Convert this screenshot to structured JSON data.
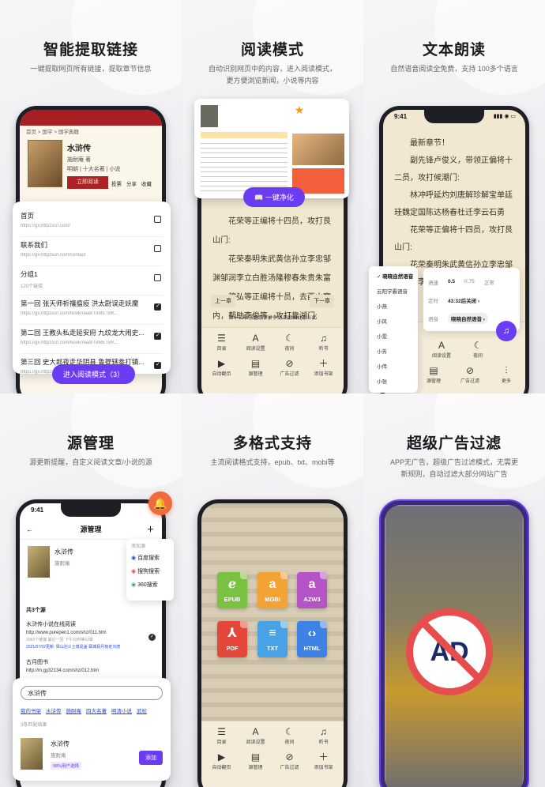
{
  "panels": [
    {
      "title": "智能提取链接",
      "subtitle": "一键提取网页所有链接，提取章节信息"
    },
    {
      "title": "阅读模式",
      "subtitle": "自动识别网页中的内容，进入阅读模式，更方便浏览新闻，小说等内容"
    },
    {
      "title": "文本朗读",
      "subtitle": "自然语音阅读全免费，支持 100多个语言"
    },
    {
      "title": "源管理",
      "subtitle": "源更新提醒，自定义阅读文章/小说的源"
    },
    {
      "title": "多格式支持",
      "subtitle": "主流阅读格式支持，epub、txt、mobi等"
    },
    {
      "title": "超级广告过滤",
      "subtitle": "APP无广告，超级广告过滤模式，无需更新规则，自动过滤大部分网站广告"
    }
  ],
  "p1": {
    "breadcrumb": "首页 > 国学 > 国学典籍",
    "book_title": "水浒传",
    "author": "施耐庵 著",
    "tags": "明朝 | 十大名著 | 小说",
    "read_btn": "立即阅读",
    "actions": [
      "投票",
      "分享",
      "收藏"
    ],
    "links": [
      {
        "title": "首页",
        "url": "https://gx.httpzscn.com/"
      },
      {
        "title": "联系我们",
        "url": "https://gx.httpzscn.com/contact"
      },
      {
        "title": "分组1",
        "url": "120个链接"
      },
      {
        "title": "第一回 张天师祈禳瘟疫 洪太尉误走妖魔",
        "url": "https://gx.httpzscn.com/book/read/T8METBK..."
      },
      {
        "title": "第二回 王教头私走延安府 九纹龙大闹史...",
        "url": "https://gx.httpzscn.com/book/read/T8METBK..."
      },
      {
        "title": "第三回 史大郎夜走华阴县 鲁提辖拳打镇...",
        "url": "https://gx.httpzscn.com/book/read/T8METBK..."
      }
    ],
    "enter_btn": "进入阅读模式（3）"
  },
  "p2": {
    "clean_btn": "一键净化",
    "paragraphs": [
      "花荣等正编将十四员，攻打艮山门:",
      "花荣秦明朱武黄信孙立李忠邹渊邹润李立白胜汤隆穆春朱贵朱富",
      "穆弘等正编将十员，去西山寨内，帮助李俊等，攻打靠湖门:"
    ],
    "prev": "上一章",
    "next": "下一章",
    "chapter": "第十三章 放色情节拼争动 再掀国北京斗武",
    "toolbar1": [
      "目录",
      "阅读设置",
      "夜间",
      "听书"
    ],
    "toolbar2": [
      "自动翻页",
      "源管理",
      "广告过滤",
      "添加书架"
    ]
  },
  "p3": {
    "time": "9:41",
    "paragraphs": [
      "最新章节！",
      "副先锋卢俊义，带领正偏将十二员，攻打候潮门:",
      "林冲呼延灼刘唐解珍解宝单廷珪魏定国陈达杨春杜迁李云石勇",
      "花荣等正偏将十四员，攻打艮山门:",
      "花荣秦明朱武黄信孙立李忠邹渊邹润李立白胜汤隆穆春朱贵朱富",
      "穆弘等正偏将十员，去西山寨内，帮助李俊"
    ],
    "voices": [
      "晓晓自然语音",
      "云阳学霸语音",
      "小燕",
      "小风",
      "小雯",
      "小芳",
      "小伟",
      "小张"
    ],
    "speed_label": "语速",
    "speeds": [
      "0.5",
      "0.75",
      "正常"
    ],
    "timer_label": "定时",
    "timer_value": "43:32后关闭 ›",
    "voice_label": "语音",
    "voice_value": "晓晓自然语音 ›",
    "toolbar": [
      "阅读设置",
      "夜间",
      "源管理",
      "广告过滤",
      "更多"
    ]
  },
  "p4": {
    "time": "9:41",
    "header": "源管理",
    "book_title": "水浒传",
    "book_author": "施耐庵",
    "source_count": "共3个源",
    "sources": [
      {
        "name": "水浒传小说在线阅读",
        "url": "http://www.purepen1.com/shz/011.htm",
        "meta": "2062个链接  最近一回 下午10时等12章",
        "note": "2021/07/02更新: 梁山泊义士尊晁盖 郓城县月夜走刘唐"
      },
      {
        "name": "古月图书",
        "url": "http://m.gy32134.com/shz/012.htm",
        "meta": "",
        "note": ""
      }
    ],
    "engine_title": "添加源",
    "engines": [
      "百度搜索",
      "搜狗搜索",
      "360搜索"
    ],
    "search_value": "水浒传",
    "search_tags": [
      "我的书架",
      "水浒传",
      "施耐庵",
      "四大名著",
      "明清小说",
      "武松"
    ],
    "result_count": "3条匹配结果",
    "result_title": "水浒传",
    "result_author": "施耐庵",
    "result_badge": "98%用户选择",
    "add_btn": "添加"
  },
  "p5": {
    "formats": [
      {
        "name": "EPUB",
        "glyph": "ℯ",
        "color": "#7cc242"
      },
      {
        "name": "MOBI",
        "glyph": "a",
        "color": "#f2a334"
      },
      {
        "name": "AZW3",
        "glyph": "a",
        "color": "#b653c7"
      },
      {
        "name": "PDF",
        "glyph": "⅄",
        "color": "#e4473a"
      },
      {
        "name": "TXT",
        "glyph": "≡",
        "color": "#4aa2e6"
      },
      {
        "name": "HTML",
        "glyph": "‹›",
        "color": "#3d82e4"
      }
    ],
    "toolbar1": [
      "目录",
      "阅读设置",
      "夜间",
      "听书"
    ],
    "toolbar2": [
      "自动翻页",
      "源管理",
      "广告过滤",
      "添加书架"
    ]
  },
  "p6": {
    "ad_text": "AD"
  },
  "colors": {
    "accent": "#6b3df2",
    "bell": "#f06a40",
    "ad_red": "#e84d4d"
  }
}
